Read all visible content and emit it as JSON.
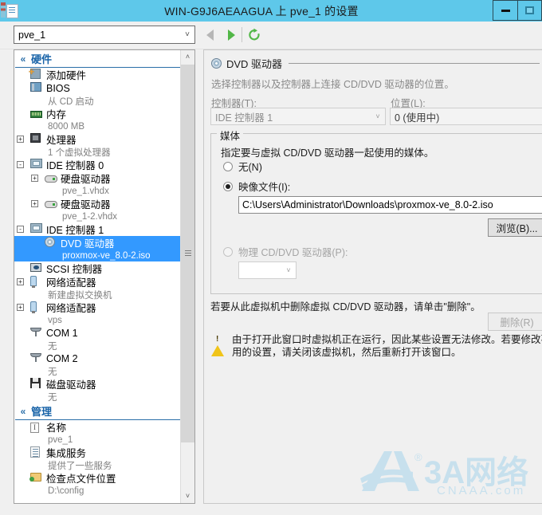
{
  "window": {
    "title": "WIN-G9J6AEAAGUA 上 pve_1 的设置",
    "icon": "settings-document-icon",
    "minimize_label": "最小化",
    "maximize_label": "最大化"
  },
  "toolbar": {
    "vm_selector": {
      "value": "pve_1",
      "arrow": "˅"
    },
    "back_label": "后退",
    "forward_label": "前进",
    "refresh_label": "刷新"
  },
  "sidebar": {
    "sections": [
      {
        "title": "硬件",
        "chevron": "«",
        "items": [
          {
            "label": "添加硬件",
            "sub": "",
            "icon": "add-hardware-icon",
            "indent": 1,
            "expander": ""
          },
          {
            "label": "BIOS",
            "sub": "从 CD 启动",
            "icon": "bios-icon",
            "indent": 1,
            "expander": ""
          },
          {
            "label": "内存",
            "sub": "8000 MB",
            "icon": "memory-icon",
            "indent": 1,
            "expander": ""
          },
          {
            "label": "处理器",
            "sub": "1 个虚拟处理器",
            "icon": "processor-icon",
            "indent": 1,
            "expander": "+"
          },
          {
            "label": "IDE 控制器 0",
            "sub": "",
            "icon": "ide-controller-icon",
            "indent": 1,
            "expander": "-"
          },
          {
            "label": "硬盘驱动器",
            "sub": "pve_1.vhdx",
            "icon": "hard-drive-icon",
            "indent": 2,
            "expander": "+"
          },
          {
            "label": "硬盘驱动器",
            "sub": "pve_1-2.vhdx",
            "icon": "hard-drive-icon",
            "indent": 2,
            "expander": "+"
          },
          {
            "label": "IDE 控制器 1",
            "sub": "",
            "icon": "ide-controller-icon",
            "indent": 1,
            "expander": "-"
          },
          {
            "label": "DVD 驱动器",
            "sub": "proxmox-ve_8.0-2.iso",
            "icon": "dvd-drive-icon",
            "indent": 2,
            "expander": "",
            "selected": true
          },
          {
            "label": "SCSI 控制器",
            "sub": "",
            "icon": "scsi-controller-icon",
            "indent": 1,
            "expander": ""
          },
          {
            "label": "网络适配器",
            "sub": "新建虚拟交换机",
            "icon": "network-adapter-icon",
            "indent": 1,
            "expander": "+"
          },
          {
            "label": "网络适配器",
            "sub": "vps",
            "icon": "network-adapter-icon",
            "indent": 1,
            "expander": "+"
          },
          {
            "label": "COM 1",
            "sub": "无",
            "icon": "com-port-icon",
            "indent": 1,
            "expander": ""
          },
          {
            "label": "COM 2",
            "sub": "无",
            "icon": "com-port-icon",
            "indent": 1,
            "expander": ""
          },
          {
            "label": "磁盘驱动器",
            "sub": "无",
            "icon": "floppy-drive-icon",
            "indent": 1,
            "expander": ""
          }
        ]
      },
      {
        "title": "管理",
        "chevron": "«",
        "items": [
          {
            "label": "名称",
            "sub": "pve_1",
            "icon": "name-icon",
            "indent": 1,
            "expander": ""
          },
          {
            "label": "集成服务",
            "sub": "提供了一些服务",
            "icon": "integration-services-icon",
            "indent": 1,
            "expander": ""
          },
          {
            "label": "检查点文件位置",
            "sub": "D:\\config",
            "icon": "checkpoint-folder-icon",
            "indent": 1,
            "expander": ""
          }
        ]
      }
    ],
    "scrollbar": {
      "up": "˄",
      "down": "˅"
    }
  },
  "detail": {
    "header": {
      "title": "DVD 驱动器",
      "icon": "dvd-drive-icon"
    },
    "description": "选择控制器以及控制器上连接 CD/DVD 驱动器的位置。",
    "controller": {
      "label": "控制器(T):",
      "value": "IDE 控制器 1",
      "arrow": "˅",
      "disabled": true
    },
    "location": {
      "label": "位置(L):",
      "value": "0 (使用中)",
      "disabled": true
    },
    "media_group": {
      "title": "媒体",
      "description": "指定要与虚拟 CD/DVD 驱动器一起使用的媒体。",
      "options": [
        {
          "label": "无(N)",
          "checked": false,
          "disabled": false,
          "name": "none"
        },
        {
          "label": "映像文件(I):",
          "checked": true,
          "disabled": false,
          "name": "image-file"
        },
        {
          "label": "物理 CD/DVD 驱动器(P):",
          "checked": false,
          "disabled": true,
          "name": "physical-drive"
        }
      ],
      "image_path": "C:\\Users\\Administrator\\Downloads\\proxmox-ve_8.0-2.iso",
      "browse_button": "浏览(B)...",
      "physical_drive_value": "",
      "physical_drive_arrow": "˅"
    },
    "remove_note": "若要从此虚拟机中删除虚拟 CD/DVD 驱动器，请单击\"删除\"。",
    "remove_button": {
      "label": "删除(R)",
      "disabled": true
    },
    "warning": {
      "icon": "warning-icon",
      "line1": "由于打开此窗口时虚拟机正在运行，因此某些设置无法修改。若要修改不可",
      "line2": "用的设置，请关闭该虚拟机，然后重新打开该窗口。"
    }
  },
  "watermark": {
    "brand": "3A网络",
    "domain": "CNAAA.com",
    "mark": "A",
    "registered": "®"
  },
  "colors": {
    "titlebar": "#5ec8ea",
    "selection": "#3399ff",
    "section_title": "#1863a8",
    "warning": "#f0c419",
    "watermark": "#9ecfe8"
  }
}
